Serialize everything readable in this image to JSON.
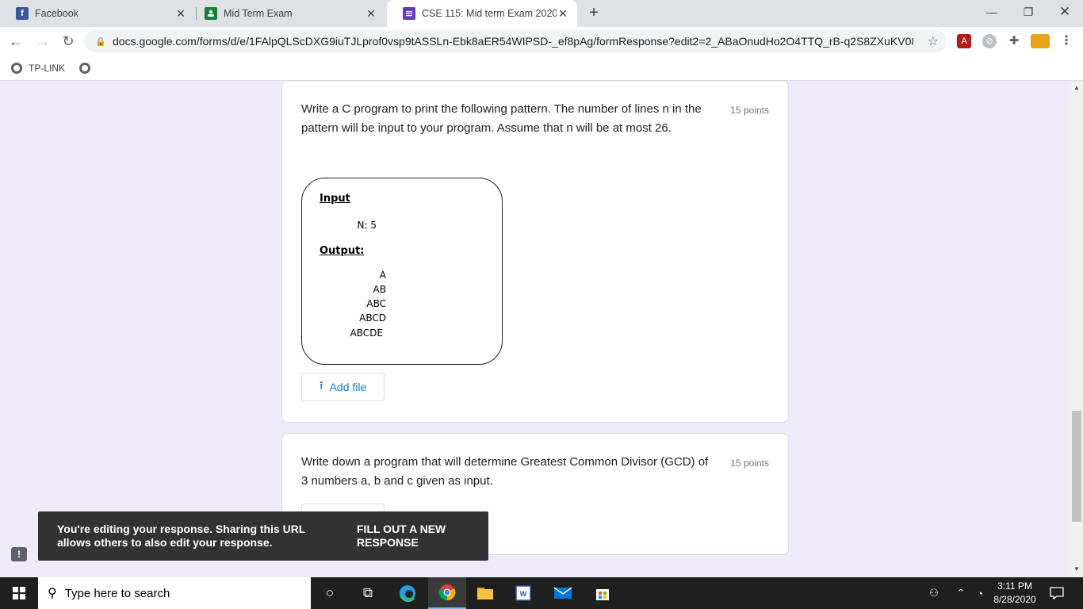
{
  "browser": {
    "tabs": [
      {
        "title": "Facebook",
        "favicon_text": "f",
        "favicon_color": "#3b5998"
      },
      {
        "title": "Mid Term Exam",
        "favicon_text": "",
        "favicon_color": "#188038"
      },
      {
        "title": "CSE 115: Mid term Exam 2020",
        "favicon_text": "",
        "favicon_color": "#673ab7"
      }
    ],
    "url": "docs.google.com/forms/d/e/1FAlpQLScDXG9iuTJLprof0vsp9tASSLn-Ebk8aER54WIPSD-_ef8pAg/formResponse?edit2=2_ABaOnudHo2O4TTQ_rB-q2S8ZXuKV08skc...",
    "bookmark": "TP-LINK"
  },
  "questions": [
    {
      "text": "Write a C program to print the following pattern. The number of lines n in the pattern will be input to your program. Assume that n will be at most 26.",
      "points": "15 points",
      "pattern": {
        "input_label": "Input",
        "input_value": "N: 5",
        "output_label": "Output:",
        "lines": [
          "A",
          "AB",
          "ABC",
          "ABCD",
          "ABCDE"
        ]
      },
      "add_file_label": "Add file"
    },
    {
      "text": "Write down a program that will determine Greatest Common Divisor (GCD) of 3 numbers a, b and c given as input.",
      "points": "15 points"
    }
  ],
  "snackbar": {
    "message": "You're editing your response. Sharing this URL allows others to also edit your response.",
    "action": "FILL OUT A NEW RESPONSE"
  },
  "taskbar": {
    "search_placeholder": "Type here to search",
    "time": "3:11 PM",
    "date": "8/28/2020"
  }
}
